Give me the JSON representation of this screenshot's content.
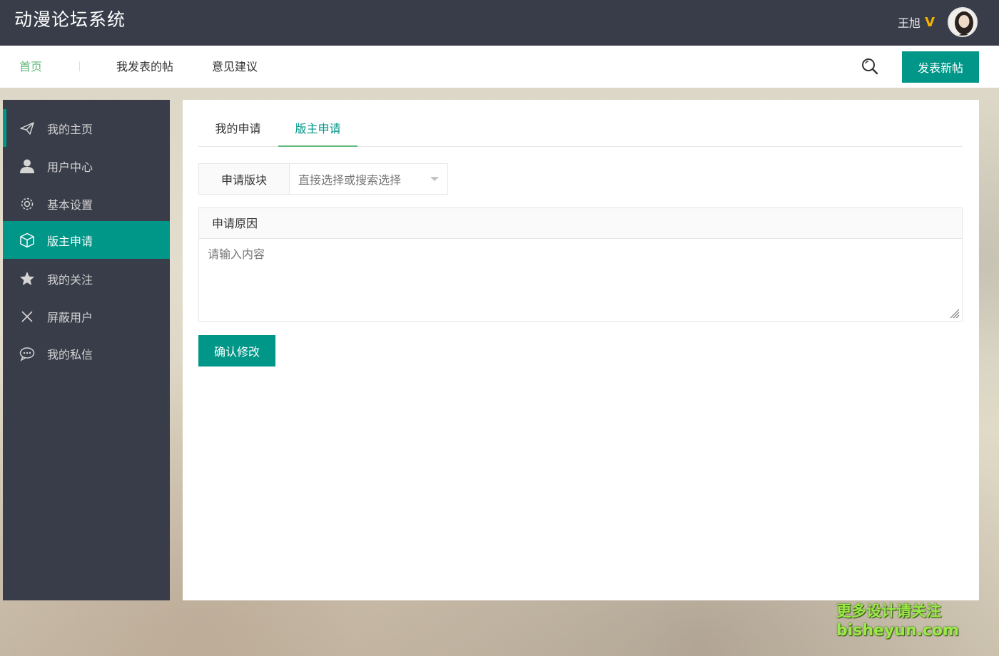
{
  "header": {
    "app_title": "动漫论坛系统",
    "username": "王旭",
    "vip_badge": "V"
  },
  "nav": {
    "items": [
      {
        "label": "首页",
        "active": true
      },
      {
        "label": "我发表的帖",
        "active": false
      },
      {
        "label": "意见建议",
        "active": false
      }
    ],
    "search_icon": "search-icon",
    "post_button": "发表新帖"
  },
  "sidebar": {
    "items": [
      {
        "label": "我的主页",
        "icon": "paper-plane-icon",
        "active": false
      },
      {
        "label": "用户中心",
        "icon": "user-icon",
        "active": false
      },
      {
        "label": "基本设置",
        "icon": "gear-icon",
        "active": false
      },
      {
        "label": "版主申请",
        "icon": "cube-icon",
        "active": true
      },
      {
        "label": "我的关注",
        "icon": "star-icon",
        "active": false
      },
      {
        "label": "屏蔽用户",
        "icon": "close-icon",
        "active": false
      },
      {
        "label": "我的私信",
        "icon": "chat-icon",
        "active": false
      }
    ]
  },
  "main": {
    "tabs": [
      {
        "label": "我的申请",
        "active": false
      },
      {
        "label": "版主申请",
        "active": true
      }
    ],
    "section_field": {
      "label": "申请版块",
      "placeholder": "直接选择或搜索选择"
    },
    "reason_field": {
      "label": "申请原因",
      "placeholder": "请输入内容"
    },
    "confirm_button": "确认修改"
  },
  "watermark": {
    "line1": "更多设计请关注",
    "line2": "bisheyun.com"
  },
  "colors": {
    "header_bg": "#393d49",
    "accent": "#009688",
    "nav_active": "#5fb878",
    "vip": "#f5b400"
  }
}
